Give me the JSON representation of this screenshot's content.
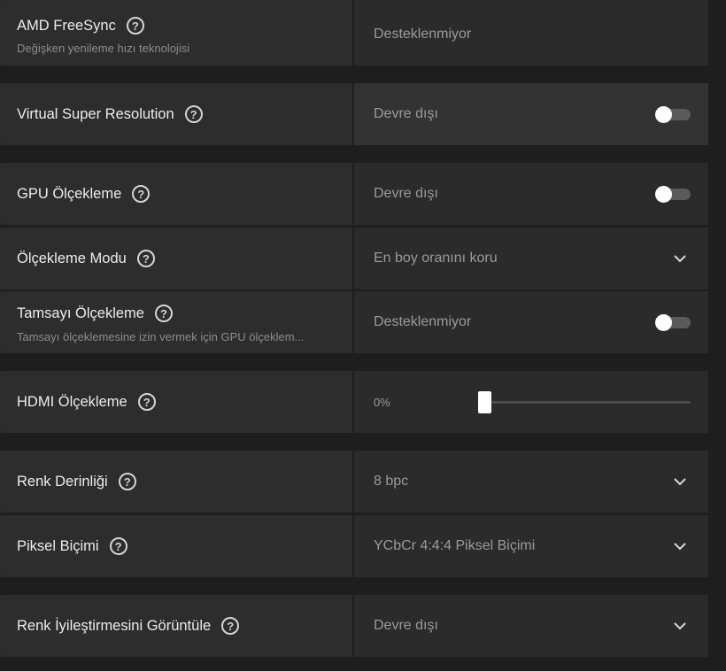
{
  "settings": [
    {
      "title": "AMD FreeSync",
      "subtitle": "Değişken yenileme hızı teknolojisi",
      "value": "Desteklenmiyor",
      "control": "none"
    },
    {
      "title": "Virtual Super Resolution",
      "subtitle": "",
      "value": "Devre dışı",
      "control": "toggle",
      "toggle_on": false
    },
    {
      "title": "GPU Ölçekleme",
      "subtitle": "",
      "value": "Devre dışı",
      "control": "toggle",
      "toggle_on": false
    },
    {
      "title": "Ölçekleme Modu",
      "subtitle": "",
      "value": "En boy oranını koru",
      "control": "dropdown"
    },
    {
      "title": "Tamsayı Ölçekleme",
      "subtitle": "Tamsayı ölçeklemesine izin vermek için GPU ölçeklem...",
      "value": "Desteklenmiyor",
      "control": "toggle",
      "toggle_on": false
    },
    {
      "title": "HDMI Ölçekleme",
      "subtitle": "",
      "value": "0%",
      "control": "slider",
      "slider_value": 0
    },
    {
      "title": "Renk Derinliği",
      "subtitle": "",
      "value": "8 bpc",
      "control": "dropdown"
    },
    {
      "title": "Piksel Biçimi",
      "subtitle": "",
      "value": "YCbCr 4:4:4 Piksel Biçimi",
      "control": "dropdown"
    },
    {
      "title": "Renk İyileştirmesini Görüntüle",
      "subtitle": "",
      "value": "Devre dışı",
      "control": "dropdown"
    }
  ],
  "help_glyph": "?",
  "icons": {
    "help": "question-circle-icon",
    "dropdown": "chevron-down-icon"
  },
  "colors": {
    "background": "#1e1e1e",
    "row": "#2d2d2d",
    "text": "#ececec",
    "muted": "#9a9a9a",
    "toggle_off": "#5a5a5a"
  }
}
